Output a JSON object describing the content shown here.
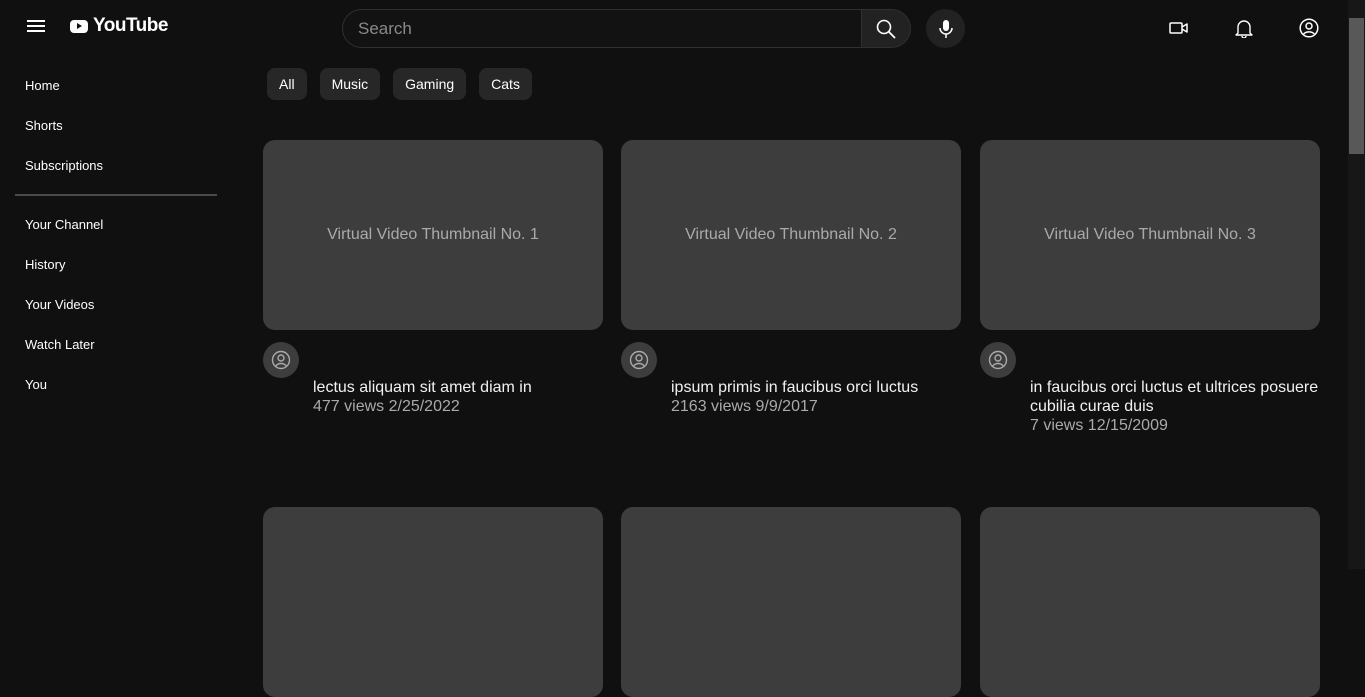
{
  "header": {
    "logo_text": "YouTube",
    "search_placeholder": "Search"
  },
  "icons": {
    "menu": "menu-icon",
    "search": "search-icon",
    "mic": "mic-icon",
    "create": "video-camera-icon",
    "notifications": "bell-icon",
    "account": "account-icon"
  },
  "sidebar": {
    "primary": [
      "Home",
      "Shorts",
      "Subscriptions"
    ],
    "secondary": [
      "Your Channel",
      "History",
      "Your Videos",
      "Watch Later",
      "You"
    ]
  },
  "chips": [
    "All",
    "Music",
    "Gaming",
    "Cats"
  ],
  "videos": [
    {
      "thumbnail_text": "Virtual Video Thumbnail No. 1",
      "title": "lectus aliquam sit amet diam in",
      "stats": "477 views 2/25/2022"
    },
    {
      "thumbnail_text": "Virtual Video Thumbnail No. 2",
      "title": "ipsum primis in faucibus orci luctus",
      "stats": "2163 views 9/9/2017"
    },
    {
      "thumbnail_text": "Virtual Video Thumbnail No. 3",
      "title": "in faucibus orci luctus et ultrices posuere cubilia curae duis",
      "stats": "7 views 12/15/2009"
    },
    {
      "thumbnail_text": ""
    },
    {
      "thumbnail_text": ""
    },
    {
      "thumbnail_text": ""
    }
  ],
  "colors": {
    "background": "#111010",
    "surface": "#272727",
    "thumbnail": "#3d3d3d",
    "text_secondary": "#aaaaaa"
  }
}
